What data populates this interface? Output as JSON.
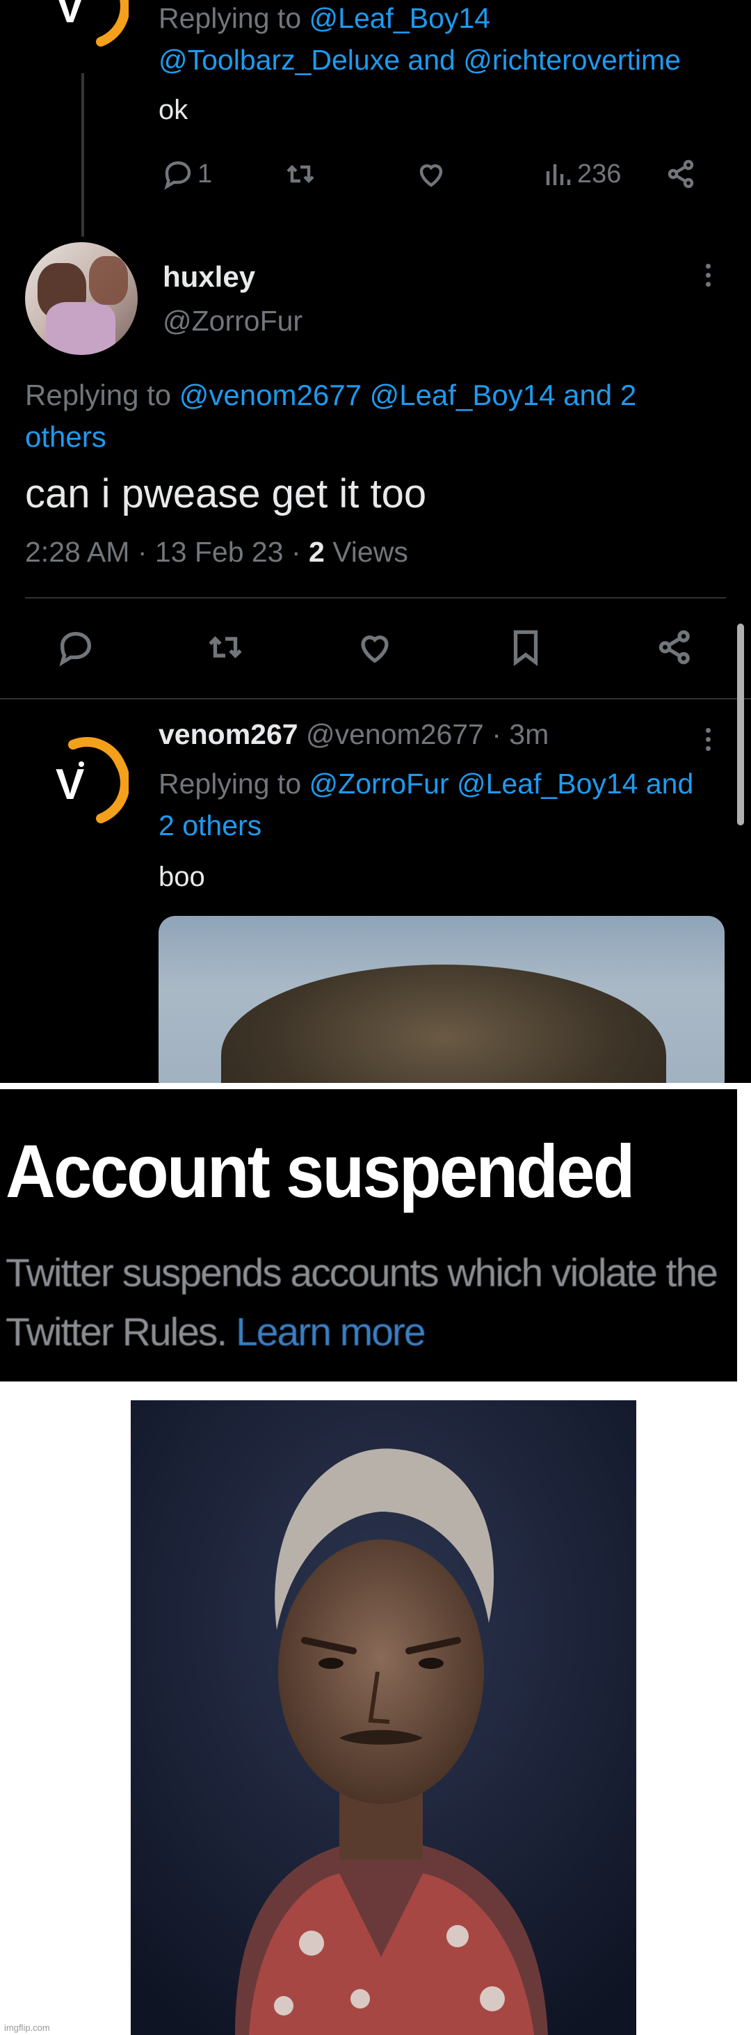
{
  "tweet1": {
    "replying_prefix": "Replying to",
    "replying_line1": "@Leaf_Boy14",
    "replying_line2": "@Toolbarz_Deluxe and @richterovertime",
    "text": "ok",
    "reply_count": "1",
    "view_count": "236"
  },
  "main_tweet": {
    "name": "huxley",
    "handle": "@ZorroFur",
    "replying_prefix": "Replying to",
    "replying_links_line1": "@venom2677 @Leaf_Boy14 and 2",
    "replying_links_line2": "others",
    "text": "can i pwease get it too",
    "time": "2:28 AM",
    "date": "13 Feb 23",
    "views_count": "2",
    "views_label": "Views"
  },
  "reply_tweet": {
    "name": "venom267",
    "handle": "@venom2677",
    "age": "· 3m",
    "replying_prefix": "Replying to",
    "replying_links_line1": "@ZorroFur @Leaf_Boy14 and",
    "replying_links_line2": "2 others",
    "text": "boo"
  },
  "suspended": {
    "title": "Account suspended",
    "message": "Twitter suspends accounts which violate the Twitter Rules.",
    "learn_more": "Learn more"
  },
  "watermark": "imgflip.com",
  "icons": [
    "reply-icon",
    "retweet-icon",
    "like-icon",
    "views-icon",
    "share-icon",
    "bookmark-icon",
    "more-icon"
  ],
  "colors": {
    "background": "#000000",
    "text": "#e7e9ea",
    "secondary": "#71767b",
    "link": "#1d9bf0",
    "logo_orange": "#f5a01a"
  }
}
